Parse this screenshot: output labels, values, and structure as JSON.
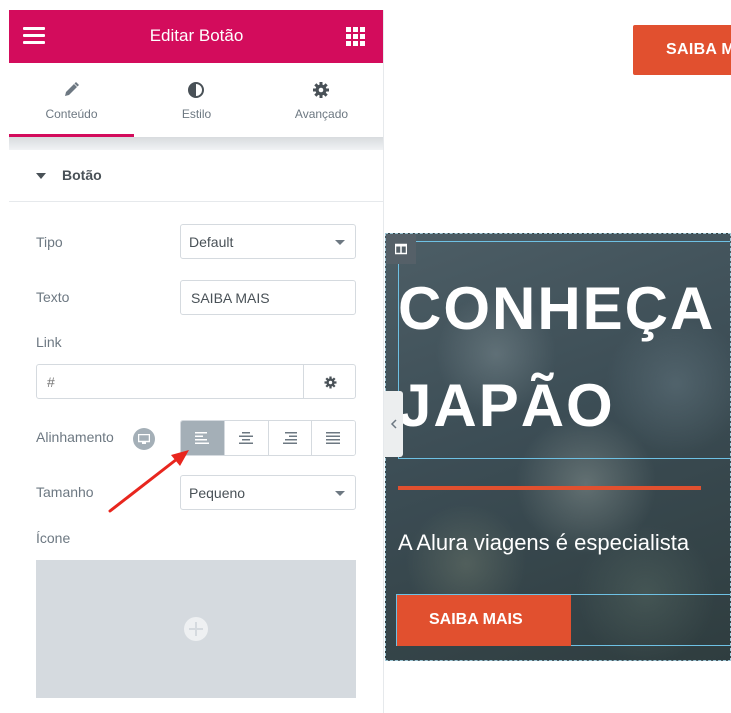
{
  "header": {
    "title": "Editar Botão",
    "menu_icon": "hamburger-icon",
    "widgets_icon": "grid-icon"
  },
  "tabs": [
    {
      "label": "Conteúdo",
      "icon": "pencil-icon",
      "active": true
    },
    {
      "label": "Estilo",
      "icon": "contrast-icon",
      "active": false
    },
    {
      "label": "Avançado",
      "icon": "gear-icon",
      "active": false
    }
  ],
  "section": {
    "title": "Botão",
    "expanded": true
  },
  "controls": {
    "tipo": {
      "label": "Tipo",
      "value": "Default"
    },
    "texto": {
      "label": "Texto",
      "value": "SAIBA MAIS"
    },
    "link": {
      "label": "Link",
      "placeholder": "#"
    },
    "alinhamento": {
      "label": "Alinhamento",
      "options": [
        "align-left",
        "align-center",
        "align-right",
        "align-justify"
      ],
      "selected": "align-left"
    },
    "tamanho": {
      "label": "Tamanho",
      "value": "Pequeno"
    },
    "icone": {
      "label": "Ícone"
    }
  },
  "preview": {
    "top_button": "SAIBA MAIS",
    "heading_line1": "CONHEÇA O",
    "heading_line2": "JAPÃO",
    "paragraph": "A Alura viagens é especialista",
    "button": "SAIBA MAIS"
  },
  "colors": {
    "brand": "#d30c5c",
    "accent": "#e1502f",
    "outline": "#6ec1e4",
    "annotation_arrow": "#e8261e"
  }
}
